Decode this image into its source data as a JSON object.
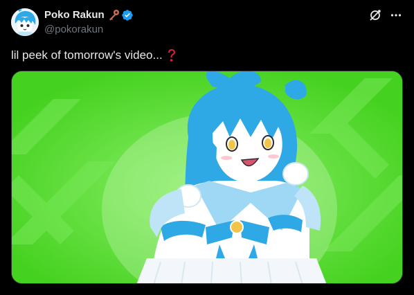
{
  "author": {
    "display_name": "Poko Rakun",
    "handle": "@pokorakun",
    "name_emoji": "key-icon",
    "verified": true
  },
  "actions": {
    "grok_icon": "grok-icon",
    "more_icon": "more-icon"
  },
  "tweet": {
    "text": "lil peek of tomorrow's video...",
    "trailing_emoji": "question-mark-icon"
  },
  "media": {
    "type": "video-thumbnail"
  },
  "colors": {
    "background": "#000000",
    "text_primary": "#e7e9ea",
    "text_secondary": "#71767b",
    "verified_blue": "#1d9bf0",
    "media_green": "#5be12d",
    "hair_blue": "#2fa8e6",
    "key_color": "#c8704d",
    "question_red": "#d8203a"
  }
}
